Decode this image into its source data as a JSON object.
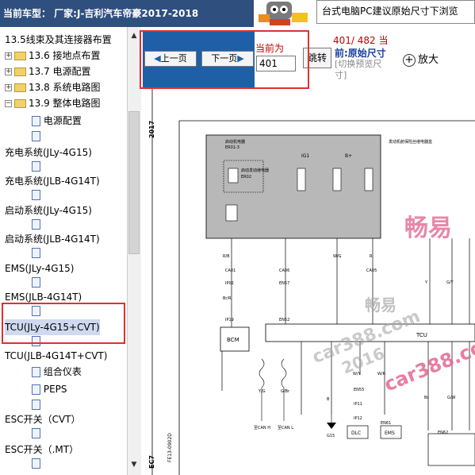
{
  "header": {
    "title": "当前车型： 厂家:J-吉利汽车帝豪2017-2018"
  },
  "banner": {
    "text": "台式电脑PC建议原始尺寸下浏览"
  },
  "tree": {
    "items": [
      {
        "label": "13.5线束及其连接器布置"
      },
      {
        "label": "13.6 接地点布置"
      },
      {
        "label": "13.7 电源配置"
      },
      {
        "label": "13.8 系统电路图"
      },
      {
        "label": "13.9 整体电路图"
      },
      {
        "label": "电源配置"
      },
      {
        "label": "充电系统(JLy-4G15)"
      },
      {
        "label": "充电系统(JLB-4G14T)"
      },
      {
        "label": "启动系统(JLy-4G15)"
      },
      {
        "label": "启动系统(JLB-4G14T)"
      },
      {
        "label": "EMS(JLy-4G15)"
      },
      {
        "label": "EMS(JLB-4G14T)"
      },
      {
        "label": "TCU(JLy-4G15+CVT)"
      },
      {
        "label": "TCU(JLB-4G14T+CVT)"
      },
      {
        "label": "组合仪表"
      },
      {
        "label": "PEPS"
      },
      {
        "label": "ESC开关（CVT）"
      },
      {
        "label": "ESC开关（.MT）"
      }
    ]
  },
  "toolbar": {
    "prev_label": "上一页",
    "next_label": "下一页",
    "current_label": "当前为",
    "page_value": "401",
    "jump_label": "跳转",
    "page_count": "401/ 482 当",
    "original_size_label": "前:原始尺寸",
    "switch_preview": "[切换预览尺寸]",
    "zoom_label": "放大"
  },
  "diagram": {
    "year": "2017",
    "code": "EC7",
    "figure_id": "FE13-0902D",
    "relay_title": "启动机电器",
    "relay_id": "ER01-3",
    "relay_box_note": "发动机舱保险丝继电器盒",
    "relay_label": "启动发动继电器",
    "relay_code": "ER02",
    "fuse_ig1": "IG1",
    "fuse_b": "B+",
    "fuses": [
      "EF15",
      "EF17",
      "EF19",
      "EF03"
    ],
    "wire_colors": [
      "R/B",
      "Br/R",
      "W/G",
      "R",
      "Y",
      "G/Y",
      "Y/G",
      "G/Br",
      "B",
      "W/Y",
      "W/R",
      "Br",
      "G/W"
    ],
    "connectors": [
      "CA01",
      "CA06",
      "CA05",
      "IP02",
      "EN57",
      "EN52",
      "IP19",
      "EN55",
      "IP11",
      "IP12",
      "EN61",
      "EN62"
    ],
    "modules": {
      "bcm": "BCM",
      "tcu": "TCU",
      "dlc": "DLC",
      "ems": "EMS"
    },
    "can_h": "至CAN H",
    "can_l": "至CAN L",
    "ground": "G15"
  },
  "watermarks": {
    "brand": "畅易",
    "site": "car388.com",
    "year": "2016"
  },
  "colors": {
    "header_bg": "#2f4f7e",
    "toolbar_blue": "#1e5fa8",
    "highlight_red": "#e03030",
    "watermark_pink": "#e0608a",
    "relay_box_gray": "#b8b8b8"
  }
}
